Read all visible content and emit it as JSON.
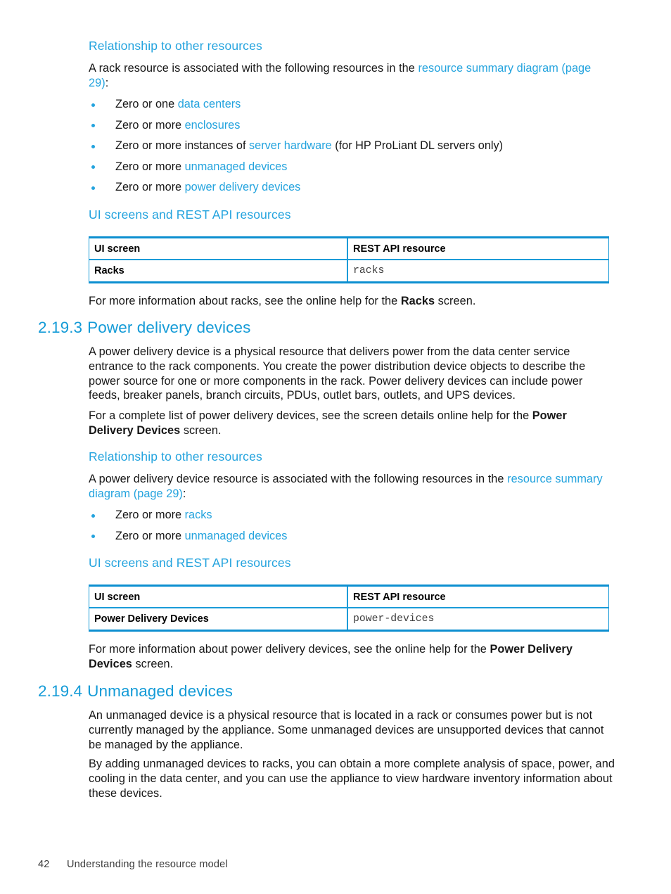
{
  "colors": {
    "heading_blue": "#149BD7",
    "subheading_blue": "#23A3DE",
    "link_blue": "#23A3DE",
    "table_border_blue": "#0C8FD0",
    "body_text": "#161616"
  },
  "sections": {
    "rack": {
      "relationship_heading": "Relationship to other resources",
      "intro_1": "A rack resource is associated with the following resources in the ",
      "intro_link": "resource summary diagram (page 29)",
      "intro_2": ":",
      "bullets": [
        {
          "prefix": "Zero or one ",
          "link": "data centers",
          "suffix": ""
        },
        {
          "prefix": "Zero or more ",
          "link": "enclosures",
          "suffix": ""
        },
        {
          "prefix": "Zero or more instances of ",
          "link": "server hardware",
          "suffix": " (for HP ProLiant DL servers only)"
        },
        {
          "prefix": "Zero or more ",
          "link": "unmanaged devices",
          "suffix": ""
        },
        {
          "prefix": "Zero or more ",
          "link": "power delivery devices",
          "suffix": ""
        }
      ],
      "ui_rest_heading": "UI screens and REST API resources",
      "table": {
        "headers": [
          "UI screen",
          "REST API resource"
        ],
        "rows": [
          [
            "Racks",
            "racks"
          ]
        ]
      },
      "after_table_1": "For more information about racks, see the online help for the ",
      "after_table_bold": "Racks",
      "after_table_2": " screen."
    },
    "power_delivery": {
      "number": "2.19.3",
      "title": "Power delivery devices",
      "para1": "A power delivery device is a physical resource that delivers power from the data center service entrance to the rack components. You create the power distribution device objects to describe the power source for one or more components in the rack. Power delivery devices can include power feeds, breaker panels, branch circuits, PDUs, outlet bars, outlets, and UPS devices.",
      "para2_1": "For a complete list of power delivery devices, see the screen details online help for the ",
      "para2_bold": "Power Delivery Devices",
      "para2_2": " screen.",
      "relationship_heading": "Relationship to other resources",
      "intro_1": "A power delivery device resource is associated with the following resources in the ",
      "intro_link": "resource summary diagram (page 29)",
      "intro_2": ":",
      "bullets": [
        {
          "prefix": "Zero or more ",
          "link": "racks",
          "suffix": ""
        },
        {
          "prefix": "Zero or more ",
          "link": "unmanaged devices",
          "suffix": ""
        }
      ],
      "ui_rest_heading": "UI screens and REST API resources",
      "table": {
        "headers": [
          "UI screen",
          "REST API resource"
        ],
        "rows": [
          [
            "Power Delivery Devices",
            "power-devices"
          ]
        ]
      },
      "after_table_1": "For more information about power delivery devices, see the online help for the ",
      "after_table_bold": "Power Delivery Devices",
      "after_table_2": " screen."
    },
    "unmanaged": {
      "number": "2.19.4",
      "title": "Unmanaged devices",
      "para1": "An unmanaged device is a physical resource that is located in a rack or consumes power but is not currently managed by the appliance. Some unmanaged devices are unsupported devices that cannot be managed by the appliance.",
      "para2": "By adding unmanaged devices to racks, you can obtain a more complete analysis of space, power, and cooling in the data center, and you can use the appliance to view hardware inventory information about these devices."
    }
  },
  "footer": {
    "page_number": "42",
    "chapter_title": "Understanding the resource model"
  }
}
